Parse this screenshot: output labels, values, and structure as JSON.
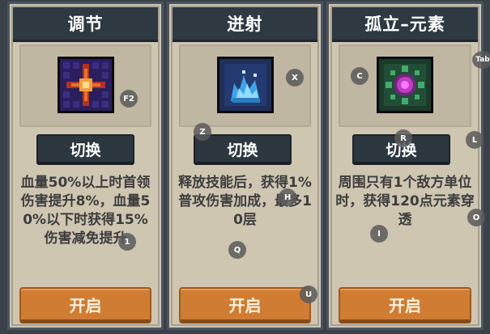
{
  "cards": [
    {
      "title": "调节",
      "icon": "cross-burst-icon",
      "switch_label": "切换",
      "description": "血量50%以上时首领伤害提升8%，血量50%以下时获得15%伤害减免提升",
      "open_label": "开启"
    },
    {
      "title": "迸射",
      "icon": "splash-wave-icon",
      "switch_label": "切换",
      "description": "释放技能后，获得1%普攻伤害加成，最多10层",
      "open_label": "开启"
    },
    {
      "title": "孤立–元素",
      "icon": "element-orb-icon",
      "switch_label": "切换",
      "description": "周围只有1个敌方单位时，获得120点元素穿透",
      "open_label": "开启"
    }
  ],
  "hotkeys": {
    "f2": "F2",
    "one": "1",
    "z": "Z",
    "x": "X",
    "h": "H",
    "q": "Q",
    "u": "U",
    "c": "C",
    "r": "R",
    "i": "I",
    "l": "L",
    "o": "O",
    "tab": "Tab"
  },
  "colors": {
    "card_bg": "#cfc6b2",
    "title_bar": "#2f3942",
    "open_button": "#d07c32",
    "text": "#3d3d3d"
  }
}
